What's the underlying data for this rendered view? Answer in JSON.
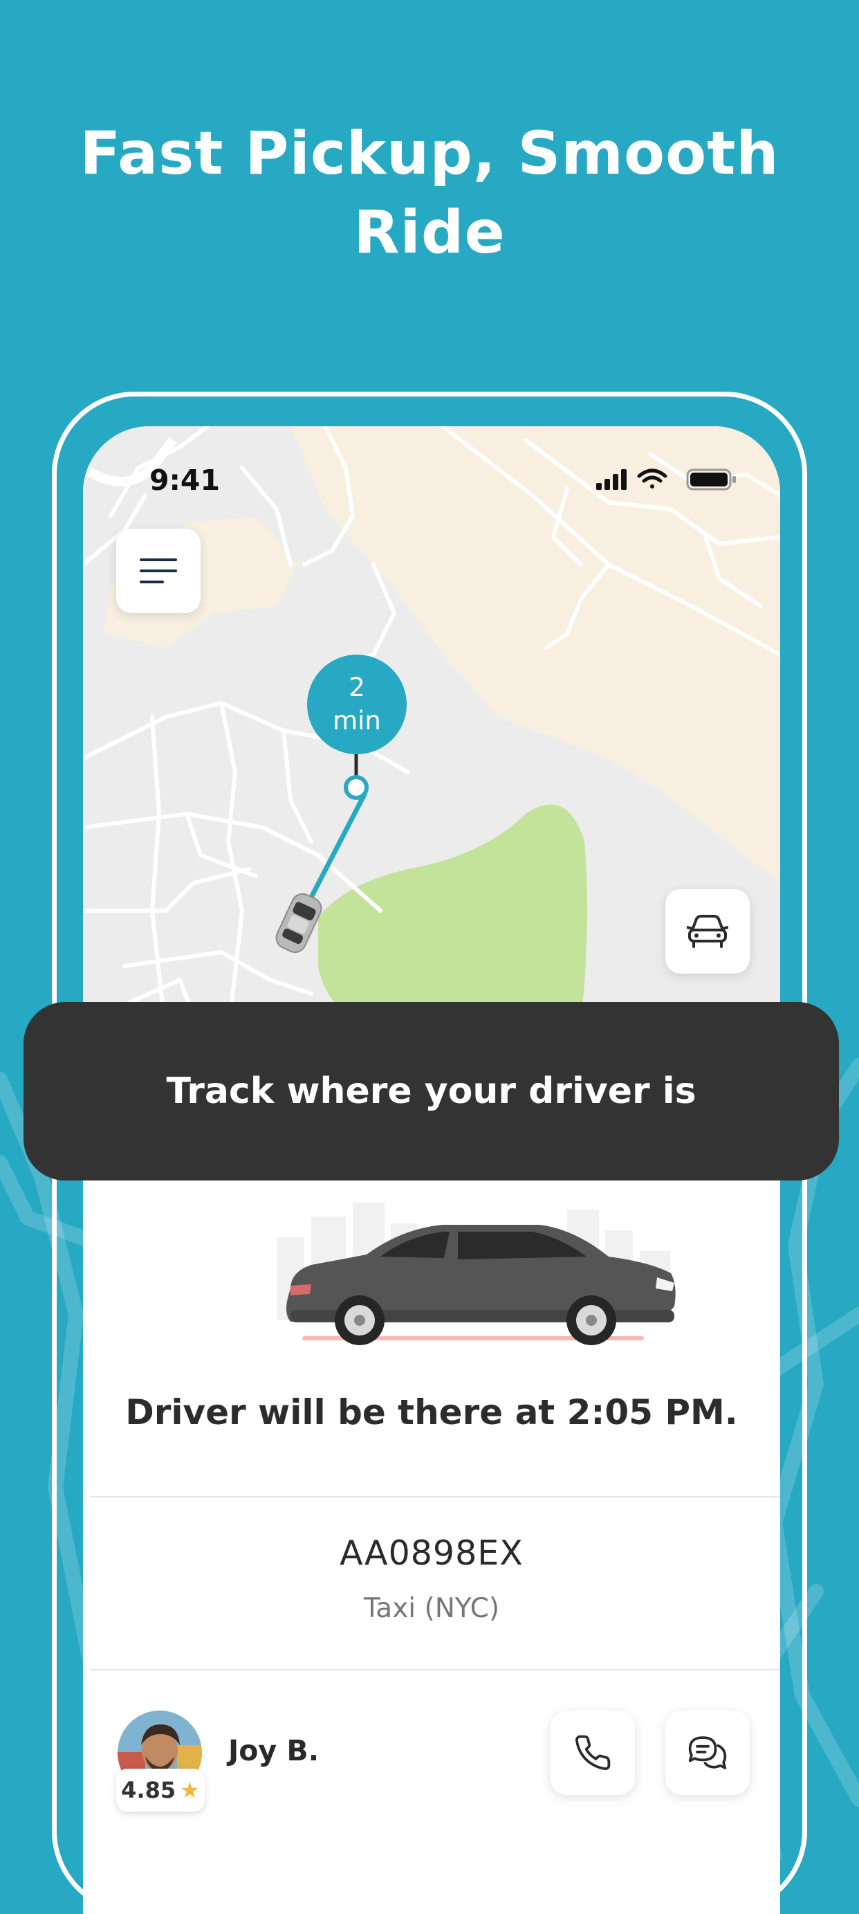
{
  "headline": {
    "line1": "Fast Pickup, Smooth",
    "line2": "Ride"
  },
  "status_bar": {
    "time": "9:41",
    "icons": [
      "signal-icon",
      "wifi-icon",
      "battery-icon"
    ]
  },
  "map": {
    "eta_value": "2",
    "eta_unit": "min",
    "menu_icon": "menu-icon",
    "vehicle_icon": "car-icon"
  },
  "banner": {
    "text": "Track where your driver is"
  },
  "ride": {
    "arrival_text": "Driver will be there at 2:05 PM.",
    "plate": "AA0898EX",
    "vehicle_type": "Taxi (NYC)"
  },
  "driver": {
    "name": "Joy B.",
    "rating": "4.85",
    "rating_icon": "star-icon",
    "actions": [
      {
        "icon": "phone-icon"
      },
      {
        "icon": "chat-icon"
      }
    ]
  },
  "colors": {
    "background": "#27a8c3",
    "accent": "#27a8c3",
    "banner": "#333333",
    "park": "#c3e29a",
    "sand": "#f8efe0",
    "map_base": "#ececec"
  }
}
